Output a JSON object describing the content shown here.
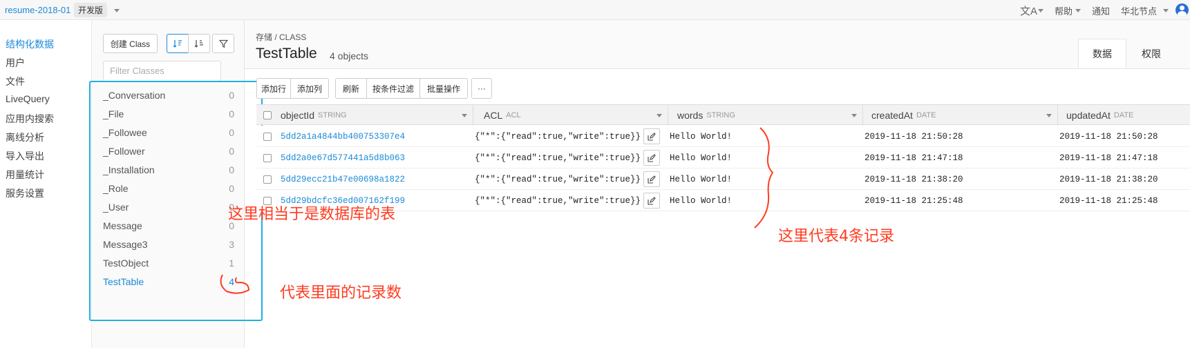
{
  "topbar": {
    "app_name": "resume-2018-01",
    "edition": "开发版",
    "translate_icon": "translate-icon",
    "help": "帮助",
    "notify": "通知",
    "region": "华北节点"
  },
  "leftnav": {
    "items": [
      {
        "label": "结构化数据",
        "active": true
      },
      {
        "label": "用户"
      },
      {
        "label": "文件"
      },
      {
        "label": "LiveQuery"
      },
      {
        "label": "应用内搜索"
      },
      {
        "label": "离线分析"
      },
      {
        "label": "导入导出"
      },
      {
        "label": "用量统计"
      },
      {
        "label": "服务设置"
      }
    ]
  },
  "classpanel": {
    "create_label": "创建 Class",
    "filter_placeholder": "Filter Classes",
    "classes": [
      {
        "name": "_Conversation",
        "count": "0"
      },
      {
        "name": "_File",
        "count": "0"
      },
      {
        "name": "_Followee",
        "count": "0"
      },
      {
        "name": "_Follower",
        "count": "0"
      },
      {
        "name": "_Installation",
        "count": "0"
      },
      {
        "name": "_Role",
        "count": "0"
      },
      {
        "name": "_User",
        "count": "0"
      },
      {
        "name": "Message",
        "count": "0"
      },
      {
        "name": "Message3",
        "count": "3"
      },
      {
        "name": "TestObject",
        "count": "1"
      },
      {
        "name": "TestTable",
        "count": "4",
        "active": true
      }
    ]
  },
  "main": {
    "breadcrumb": "存储 / CLASS",
    "title": "TestTable",
    "object_count": "4 objects",
    "tabs": [
      {
        "label": "数据",
        "active": true
      },
      {
        "label": "权限"
      }
    ],
    "toolbar": {
      "add_row": "添加行",
      "add_col": "添加列",
      "refresh": "刷新",
      "filter": "按条件过滤",
      "batch": "批量操作",
      "more": "···"
    },
    "columns": [
      {
        "name": "objectId",
        "type": "STRING"
      },
      {
        "name": "ACL",
        "type": "ACL"
      },
      {
        "name": "words",
        "type": "STRING"
      },
      {
        "name": "createdAt",
        "type": "DATE"
      },
      {
        "name": "updatedAt",
        "type": "DATE"
      }
    ],
    "rows": [
      {
        "objectId": "5dd2a1a4844bb400753307e4",
        "acl": "{\"*\":{\"read\":true,\"write\":true}}",
        "words": "Hello World!",
        "createdAt": "2019-11-18 21:50:28",
        "updatedAt": "2019-11-18 21:50:28"
      },
      {
        "objectId": "5dd2a0e67d577441a5d8b063",
        "acl": "{\"*\":{\"read\":true,\"write\":true}}",
        "words": "Hello World!",
        "createdAt": "2019-11-18 21:47:18",
        "updatedAt": "2019-11-18 21:47:18"
      },
      {
        "objectId": "5dd29ecc21b47e00698a1822",
        "acl": "{\"*\":{\"read\":true,\"write\":true}}",
        "words": "Hello World!",
        "createdAt": "2019-11-18 21:38:20",
        "updatedAt": "2019-11-18 21:38:20"
      },
      {
        "objectId": "5dd29bdcfc36ed007162f199",
        "acl": "{\"*\":{\"read\":true,\"write\":true}}",
        "words": "Hello World!",
        "createdAt": "2019-11-18 21:25:48",
        "updatedAt": "2019-11-18 21:25:48"
      }
    ]
  },
  "annotations": {
    "table_note": "这里相当于是数据库的表",
    "records_note": "这里代表4条记录",
    "count_note": "代表里面的记录数"
  },
  "colors": {
    "accent": "#1a8ad8",
    "annotation": "#ff3b1f",
    "highlight_box": "#1fb0e0"
  }
}
